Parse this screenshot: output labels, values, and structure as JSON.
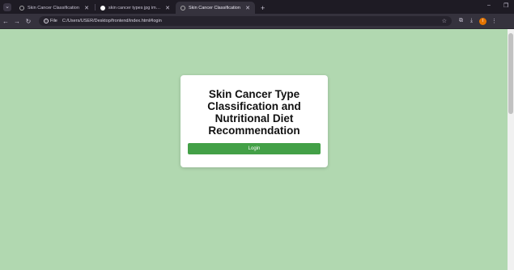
{
  "browser": {
    "tabs": [
      {
        "title": "Skin Cancer Classification",
        "active": false,
        "favicon": "globe-icon"
      },
      {
        "title": "skin cancer types jpg images...",
        "active": false,
        "favicon": "google-icon"
      },
      {
        "title": "Skin Cancer Classification",
        "active": true,
        "favicon": "globe-icon"
      }
    ],
    "new_tab_label": "+",
    "address": {
      "scheme_chip": "File",
      "url": "C:/Users/USER/Desktop/frontend/index.html#login"
    },
    "profile_initial": "I"
  },
  "page": {
    "title": "Skin Cancer Type Classification and Nutritional Diet Recommendation",
    "login_button": "Login"
  },
  "colors": {
    "page_background": "#b1d8b0",
    "button": "#43a047",
    "tabbar": "#1e1b24",
    "toolbar": "#35323d"
  }
}
